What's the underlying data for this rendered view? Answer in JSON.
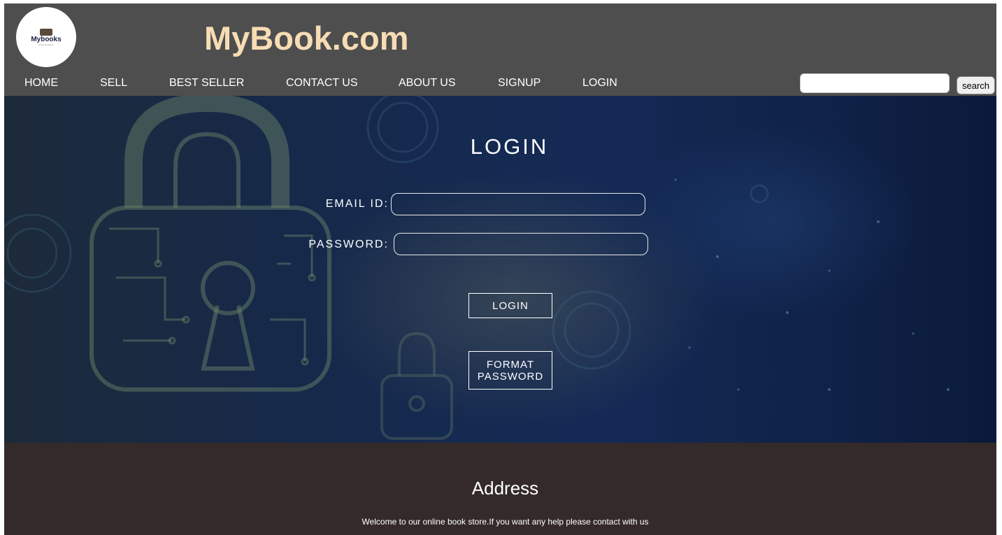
{
  "header": {
    "logo": {
      "text": "Mybooks",
      "tagline": "online bookstore"
    },
    "site_title": "MyBook.com"
  },
  "nav": {
    "items": [
      {
        "label": "HOME"
      },
      {
        "label": "SELL"
      },
      {
        "label": "BEST SELLER"
      },
      {
        "label": "CONTACT US"
      },
      {
        "label": "ABOUT US"
      },
      {
        "label": "SIGNUP"
      },
      {
        "label": "LOGIN"
      }
    ],
    "search": {
      "value": "",
      "button_label": "search"
    }
  },
  "login_form": {
    "title": "LOGIN",
    "email_label": "EMAIL ID:",
    "email_value": "",
    "password_label": "PASSWORD:",
    "password_value": "",
    "login_button": "LOGIN",
    "format_button_line1": "FORMAT",
    "format_button_line2": "PASSWORD"
  },
  "footer": {
    "title": "Address",
    "text": "Welcome to our online book store.If you want any help please contact with us"
  },
  "colors": {
    "header_bg": "#4e4e4e",
    "title_accent": "#f7dcb4",
    "footer_bg": "#342a2a",
    "hero_bg": "#142a55"
  },
  "icons": {
    "hero_decoration": "padlock-circuit-icon"
  }
}
